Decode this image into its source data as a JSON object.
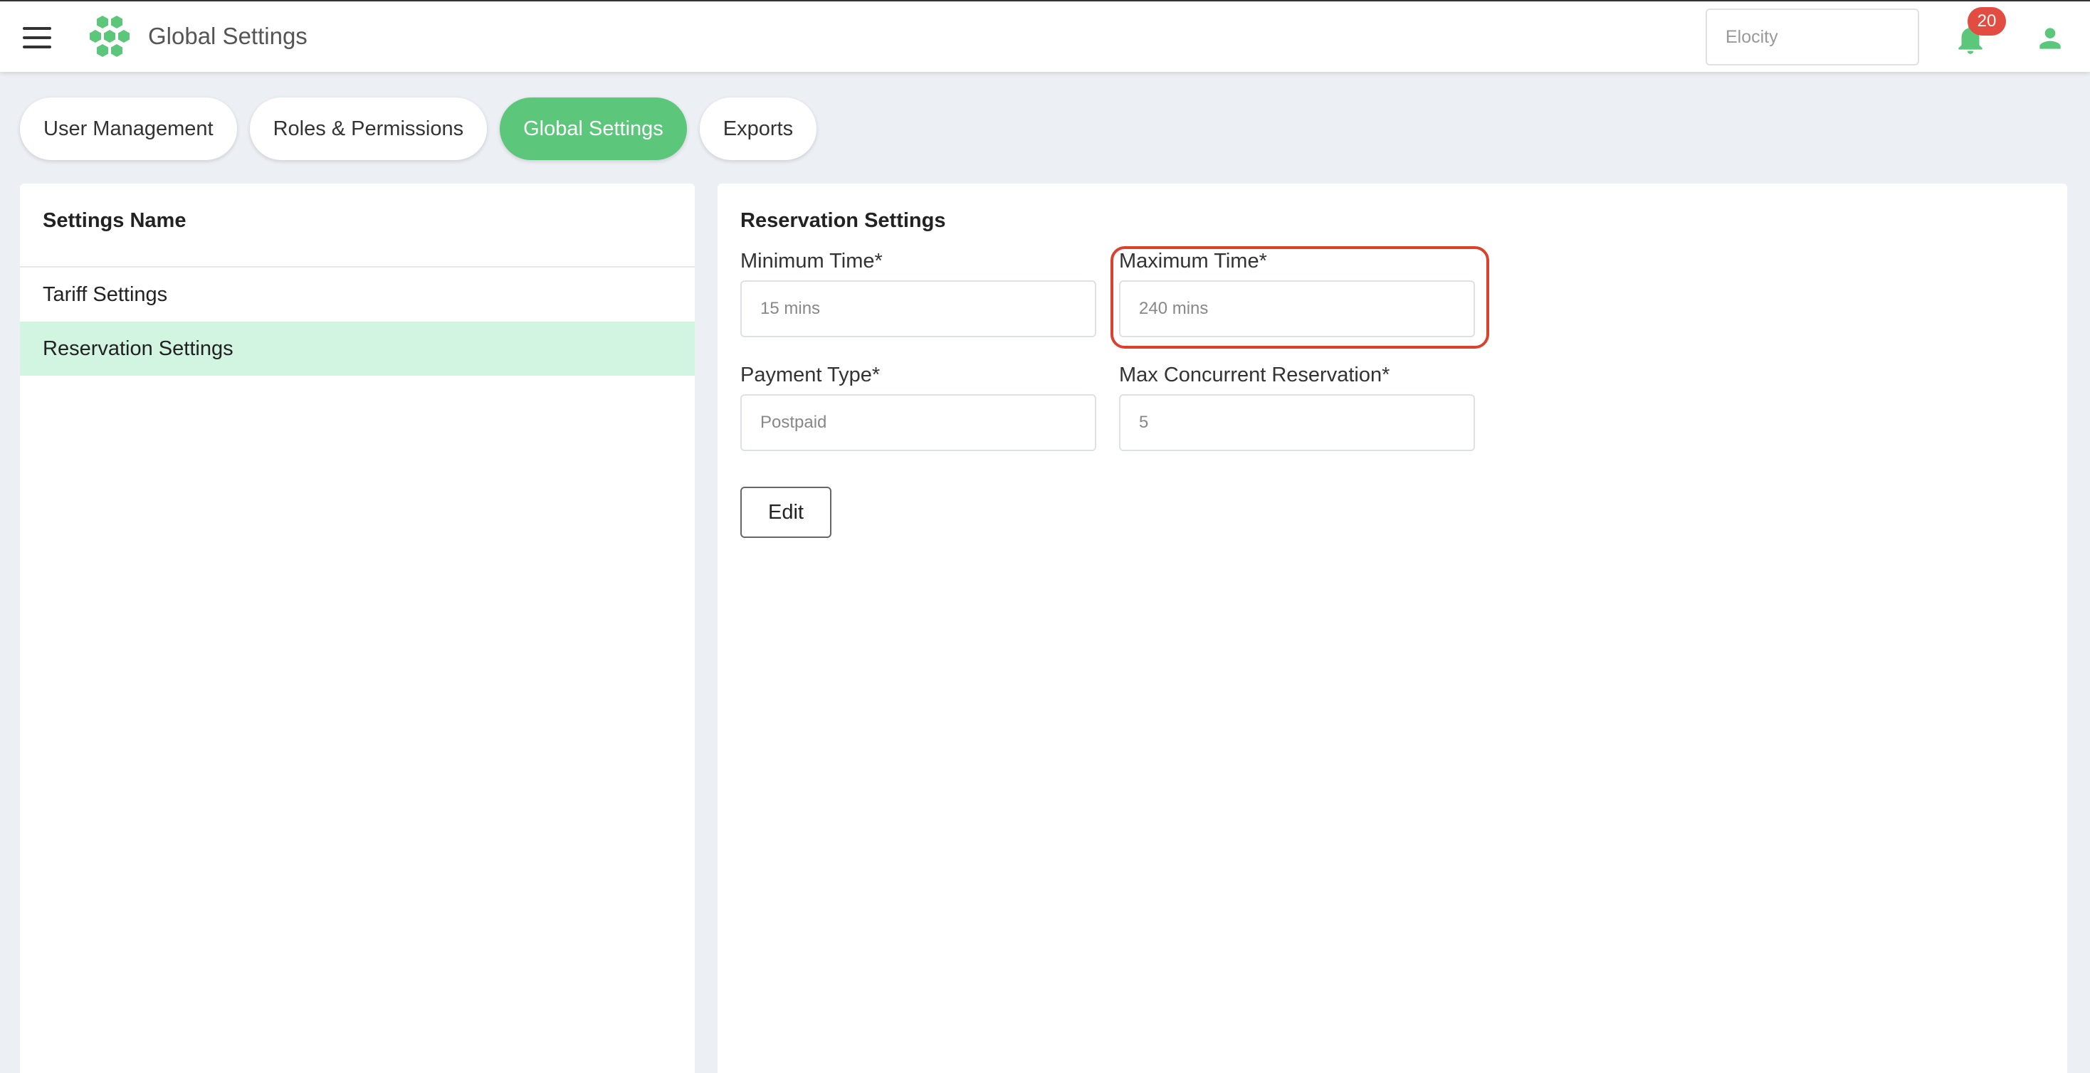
{
  "header": {
    "title": "Global Settings",
    "organization": "Elocity",
    "notification_count": "20",
    "brand_color": "#5cc77b"
  },
  "tabs": [
    {
      "label": "User Management"
    },
    {
      "label": "Roles & Permissions"
    },
    {
      "label": "Global Settings",
      "active": true
    },
    {
      "label": "Exports"
    }
  ],
  "settings_list": {
    "header": "Settings Name",
    "items": [
      {
        "label": "Tariff Settings"
      },
      {
        "label": "Reservation Settings",
        "active": true
      }
    ]
  },
  "reservation": {
    "title": "Reservation Settings",
    "min_time": {
      "label": "Minimum Time*",
      "value": "15 mins"
    },
    "max_time": {
      "label": "Maximum Time*",
      "value": "240 mins"
    },
    "payment_type": {
      "label": "Payment Type*",
      "value": "Postpaid"
    },
    "max_concurrent": {
      "label": "Max Concurrent Reservation*",
      "value": "5"
    },
    "edit_label": "Edit"
  },
  "icons": [
    "menu-icon",
    "hexagon-logo-icon",
    "bell-icon",
    "user-icon"
  ]
}
